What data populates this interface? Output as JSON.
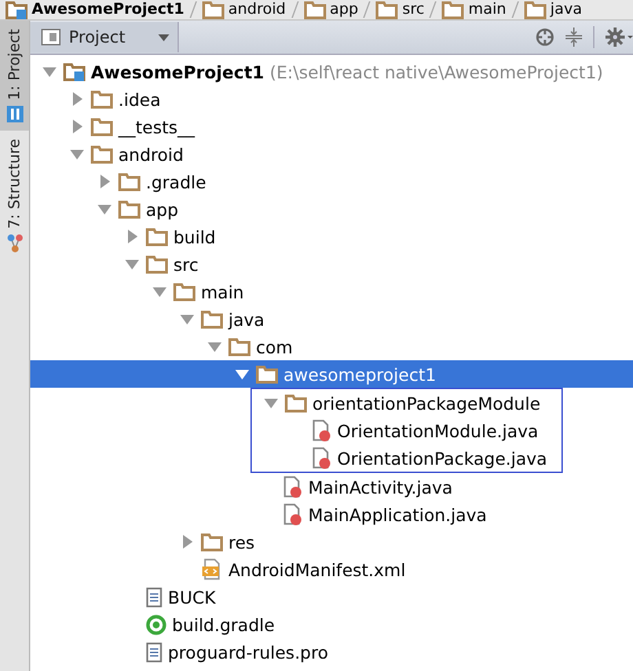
{
  "breadcrumbs": [
    {
      "label": "AwesomeProject1",
      "kind": "project"
    },
    {
      "label": "android",
      "kind": "folder"
    },
    {
      "label": "app",
      "kind": "folder"
    },
    {
      "label": "src",
      "kind": "folder"
    },
    {
      "label": "main",
      "kind": "folder"
    },
    {
      "label": "java",
      "kind": "folder"
    }
  ],
  "tool_strip": [
    {
      "label": "1: Project",
      "selected": true
    },
    {
      "label": "7: Structure",
      "selected": false
    }
  ],
  "panel": {
    "view": "Project"
  },
  "tree": [
    {
      "label": "AwesomeProject1",
      "path": "(E:\\self\\react native\\AwesomeProject1)",
      "kind": "project",
      "expanded": true,
      "selected": false,
      "children": [
        {
          "label": ".idea",
          "kind": "folder",
          "expanded": false,
          "selected": false
        },
        {
          "label": "__tests__",
          "kind": "folder",
          "expanded": false,
          "selected": false
        },
        {
          "label": "android",
          "kind": "folder",
          "expanded": true,
          "selected": false,
          "children": [
            {
              "label": ".gradle",
              "kind": "folder",
              "expanded": false,
              "selected": false
            },
            {
              "label": "app",
              "kind": "folder",
              "expanded": true,
              "selected": false,
              "children": [
                {
                  "label": "build",
                  "kind": "folder",
                  "expanded": false,
                  "selected": false
                },
                {
                  "label": "src",
                  "kind": "folder",
                  "expanded": true,
                  "selected": false,
                  "children": [
                    {
                      "label": "main",
                      "kind": "folder",
                      "expanded": true,
                      "selected": false,
                      "children": [
                        {
                          "label": "java",
                          "kind": "folder",
                          "expanded": true,
                          "selected": false,
                          "children": [
                            {
                              "label": "com",
                              "kind": "folder",
                              "expanded": true,
                              "selected": false,
                              "children": [
                                {
                                  "label": "awesomeproject1",
                                  "kind": "folder",
                                  "expanded": true,
                                  "selected": true,
                                  "children": [
                                    {
                                      "label": "orientationPackageModule",
                                      "kind": "folder",
                                      "expanded": true,
                                      "selected": false,
                                      "outlined": true,
                                      "children": [
                                        {
                                          "label": "OrientationModule.java",
                                          "kind": "java",
                                          "selected": false
                                        },
                                        {
                                          "label": "OrientationPackage.java",
                                          "kind": "java",
                                          "selected": false
                                        }
                                      ]
                                    },
                                    {
                                      "label": "MainActivity.java",
                                      "kind": "java",
                                      "selected": false
                                    },
                                    {
                                      "label": "MainApplication.java",
                                      "kind": "java",
                                      "selected": false
                                    }
                                  ]
                                }
                              ]
                            }
                          ]
                        },
                        {
                          "label": "res",
                          "kind": "folder",
                          "expanded": false,
                          "selected": false
                        },
                        {
                          "label": "AndroidManifest.xml",
                          "kind": "xml",
                          "selected": false
                        }
                      ]
                    }
                  ]
                },
                {
                  "label": "BUCK",
                  "kind": "text",
                  "selected": false
                },
                {
                  "label": "build.gradle",
                  "kind": "gradle",
                  "selected": false
                },
                {
                  "label": "proguard-rules.pro",
                  "kind": "text",
                  "selected": false
                }
              ]
            }
          ]
        }
      ]
    }
  ]
}
